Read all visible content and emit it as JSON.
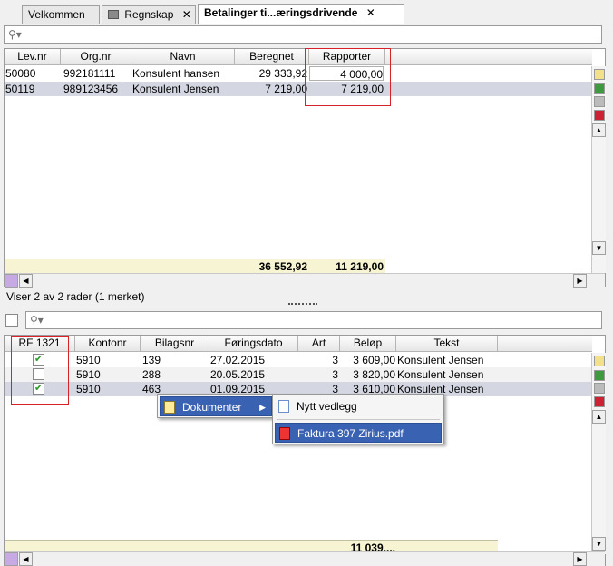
{
  "tabs": [
    {
      "label": "Velkommen"
    },
    {
      "label": "Regnskap",
      "close": "✕"
    },
    {
      "label": "Betalinger ti...æringsdrivende",
      "close": "✕"
    }
  ],
  "top_grid": {
    "columns": [
      "Lev.nr",
      "Org.nr",
      "Navn",
      "Beregnet",
      "Rapporter"
    ],
    "rows": [
      {
        "levnr": "50080",
        "orgnr": "992181111",
        "navn": "Konsulent hansen",
        "beregnet": "29 333,92",
        "rapporter": "4 000,00"
      },
      {
        "levnr": "50119",
        "orgnr": "989123456",
        "navn": "Konsulent Jensen",
        "beregnet": "7 219,00",
        "rapporter": "7 219,00"
      }
    ],
    "totals": {
      "beregnet": "36 552,92",
      "rapporter": "11 219,00"
    }
  },
  "status_text": "Viser 2 av 2 rader (1 merket)",
  "bottom_grid": {
    "columns": [
      "RF 1321",
      "Kontonr",
      "Bilagsnr",
      "Føringsdato",
      "Art",
      "Beløp",
      "Tekst"
    ],
    "rows": [
      {
        "checked": "✔",
        "kontonr": "5910",
        "bilagsnr": "139",
        "dato": "27.02.2015",
        "art": "3",
        "belop": "3 609,00",
        "tekst": "Konsulent Jensen"
      },
      {
        "checked": "",
        "kontonr": "5910",
        "bilagsnr": "288",
        "dato": "20.05.2015",
        "art": "3",
        "belop": "3 820,00",
        "tekst": "Konsulent Jensen"
      },
      {
        "checked": "✔",
        "kontonr": "5910",
        "bilagsnr": "463",
        "dato": "01.09.2015",
        "art": "3",
        "belop": "3 610,00",
        "tekst": "Konsulent Jensen"
      }
    ],
    "totals": {
      "belop": "11 039,..."
    }
  },
  "context_menu": {
    "item": "Dokumenter",
    "arrow": "▶",
    "submenu": [
      {
        "label": "Nytt vedlegg"
      },
      {
        "label": "Faktura 397 Zirius.pdf"
      }
    ]
  },
  "colors": {
    "selection": "#d4d7e2",
    "totals_bg": "#f6f4d2",
    "highlight": "#3a62b2",
    "annotation": "#d8222a"
  }
}
